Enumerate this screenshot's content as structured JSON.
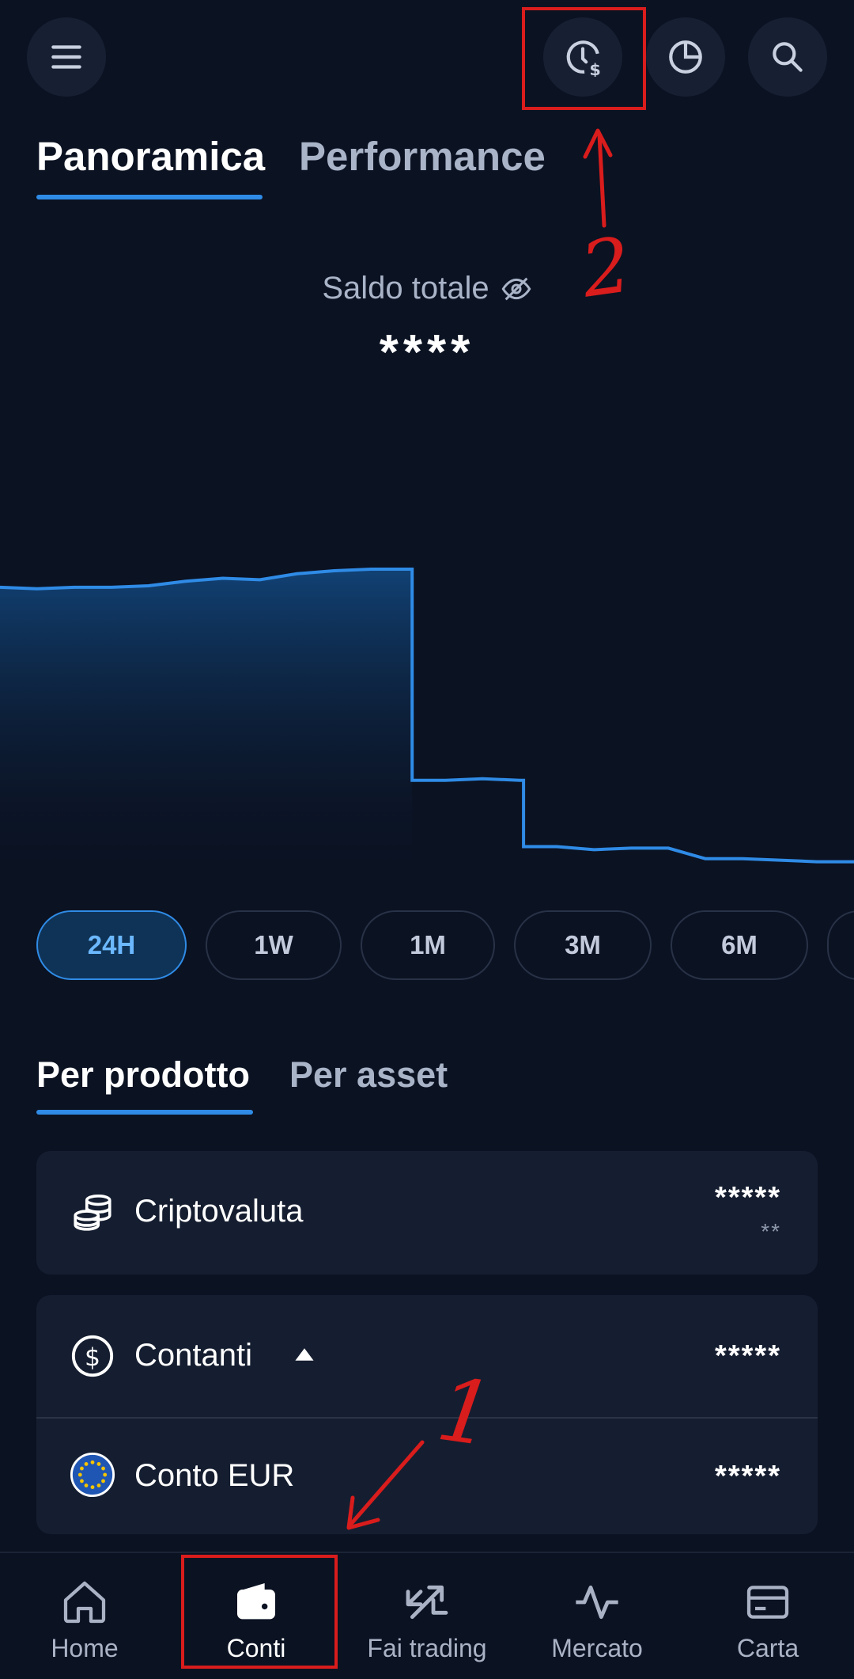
{
  "header": {
    "menu_icon": "hamburger-icon",
    "actions": [
      "clock-dollar-icon",
      "pie-chart-icon",
      "search-icon"
    ]
  },
  "top_tabs": [
    {
      "label": "Panoramica",
      "active": true
    },
    {
      "label": "Performance",
      "active": false
    }
  ],
  "balance": {
    "label": "Saldo totale",
    "value": "****",
    "visibility_icon": "eye-off-icon"
  },
  "chart_data": {
    "type": "area",
    "color": "#2f8be6",
    "note_hidden_values": true,
    "series": [
      {
        "values": [
          0.64,
          0.635,
          0.64,
          0.64,
          0.645,
          0.66,
          0.67,
          0.665,
          0.685,
          0.695,
          0.7,
          0.7,
          0.0,
          0.005,
          0.0,
          -0.22,
          -0.23,
          -0.225,
          -0.225,
          -0.26,
          -0.26,
          -0.265,
          -0.27,
          -0.27
        ]
      }
    ]
  },
  "ranges": [
    {
      "label": "24H",
      "active": true
    },
    {
      "label": "1W",
      "active": false
    },
    {
      "label": "1M",
      "active": false
    },
    {
      "label": "3M",
      "active": false
    },
    {
      "label": "6M",
      "active": false
    }
  ],
  "section_tabs": [
    {
      "label": "Per prodotto",
      "active": true
    },
    {
      "label": "Per asset",
      "active": false
    }
  ],
  "products": {
    "crypto": {
      "label": "Criptovaluta",
      "value": "*****",
      "sub": "**",
      "icon": "coins-icon"
    },
    "cash": {
      "label": "Contanti",
      "value": "*****",
      "icon": "dollar-circle-icon"
    },
    "eur": {
      "label": "Conto EUR",
      "value": "*****",
      "icon": "eu-flag-icon"
    }
  },
  "bottom_nav": [
    {
      "label": "Home",
      "icon": "home-icon",
      "active": false
    },
    {
      "label": "Conti",
      "icon": "wallet-icon",
      "active": true
    },
    {
      "label": "Fai trading",
      "icon": "trade-arrows-icon",
      "active": false
    },
    {
      "label": "Mercato",
      "icon": "activity-icon",
      "active": false
    },
    {
      "label": "Carta",
      "icon": "card-icon",
      "active": false
    }
  ],
  "annotations": {
    "marker_1": "1",
    "marker_2": "2",
    "color": "#d91c1c"
  }
}
